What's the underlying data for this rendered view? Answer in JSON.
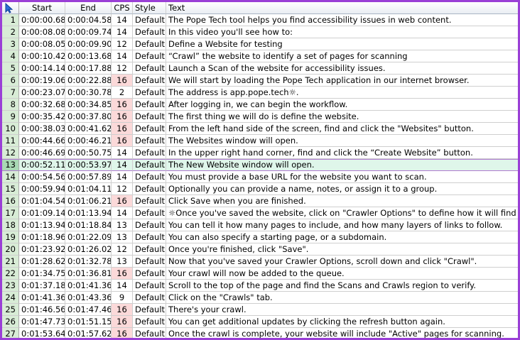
{
  "columns": {
    "num": "",
    "start": "Start",
    "end": "End",
    "cps": "CPS",
    "style": "Default_header_placeholder",
    "text": "Text"
  },
  "header_style_label": "Style",
  "selected_row": 13,
  "rows": [
    {
      "num": "1",
      "start": "0:00:00.68",
      "end": "0:00:04.58",
      "cps": "14",
      "style": "Default",
      "text": "The Pope Tech tool helps you find accessibility issues in web content."
    },
    {
      "num": "2",
      "start": "0:00:08.08",
      "end": "0:00:09.74",
      "cps": "14",
      "style": "Default",
      "text": "In this video you'll see how to:"
    },
    {
      "num": "3",
      "start": "0:00:08.05",
      "end": "0:00:09.90",
      "cps": "12",
      "style": "Default",
      "text": "Define a Website for testing"
    },
    {
      "num": "4",
      "start": "0:00:10.42",
      "end": "0:00:13.68",
      "cps": "14",
      "style": "Default",
      "text": "“Crawl” the website to identify a set of pages for scanning"
    },
    {
      "num": "5",
      "start": "0:00:14.14",
      "end": "0:00:17.88",
      "cps": "12",
      "style": "Default",
      "text": "Launch a Scan of the website for accessibility issues."
    },
    {
      "num": "6",
      "start": "0:00:19.06",
      "end": "0:00:22.88",
      "cps": "16",
      "style": "Default",
      "text": "We will start by loading the Pope Tech application in our internet browser."
    },
    {
      "num": "7",
      "start": "0:00:23.07",
      "end": "0:00:30.78",
      "cps": "2",
      "style": "Default",
      "text": "The address is app.pope.tech☼."
    },
    {
      "num": "8",
      "start": "0:00:32.68",
      "end": "0:00:34.85",
      "cps": "16",
      "style": "Default",
      "text": "After logging in, we can begin the workflow."
    },
    {
      "num": "9",
      "start": "0:00:35.42",
      "end": "0:00:37.80",
      "cps": "16",
      "style": "Default",
      "text": "The first thing we will do is define the website."
    },
    {
      "num": "10",
      "start": "0:00:38.03",
      "end": "0:00:41.62",
      "cps": "16",
      "style": "Default",
      "text": "From the left hand side of the screen, find and click the \"Websites\" button."
    },
    {
      "num": "11",
      "start": "0:00:44.66",
      "end": "0:00:46.21",
      "cps": "16",
      "style": "Default",
      "text": "The Websites window will open."
    },
    {
      "num": "12",
      "start": "0:00:46.69",
      "end": "0:00:50.75",
      "cps": "14",
      "style": "Default",
      "text": "In the upper right hand corner, find and click the “Create Website” button."
    },
    {
      "num": "13",
      "start": "0:00:52.11",
      "end": "0:00:53.97",
      "cps": "14",
      "style": "Default",
      "text": "The New Website window will open."
    },
    {
      "num": "14",
      "start": "0:00:54.56",
      "end": "0:00:57.89",
      "cps": "14",
      "style": "Default",
      "text": "You must provide a base URL for the website you want to scan."
    },
    {
      "num": "15",
      "start": "0:00:59.94",
      "end": "0:01:04.11",
      "cps": "12",
      "style": "Default",
      "text": "Optionally you can provide a name, notes, or assign it to a group."
    },
    {
      "num": "16",
      "start": "0:01:04.54",
      "end": "0:01:06.21",
      "cps": "16",
      "style": "Default",
      "text": "Click Save when you are finished."
    },
    {
      "num": "17",
      "start": "0:01:09.14",
      "end": "0:01:13.94",
      "cps": "14",
      "style": "Default",
      "text": "☼Once you've saved the website, click on \"Crawler Options\" to define how it will find pages."
    },
    {
      "num": "18",
      "start": "0:01:13.94",
      "end": "0:01:18.84",
      "cps": "13",
      "style": "Default",
      "text": "You can tell it how many pages to include, and how many layers of links to follow."
    },
    {
      "num": "19",
      "start": "0:01:18.96",
      "end": "0:01:22.09",
      "cps": "13",
      "style": "Default",
      "text": "You can also specify a starting page, or a subdomain."
    },
    {
      "num": "20",
      "start": "0:01:23.92",
      "end": "0:01:26.02",
      "cps": "12",
      "style": "Default",
      "text": "Once you're finished, click \"Save\"."
    },
    {
      "num": "21",
      "start": "0:01:28.62",
      "end": "0:01:32.78",
      "cps": "13",
      "style": "Default",
      "text": "Now that you've saved your Crawler Options, scroll down and click \"Crawl\"."
    },
    {
      "num": "22",
      "start": "0:01:34.75",
      "end": "0:01:36.81",
      "cps": "16",
      "style": "Default",
      "text": "Your crawl will now be added to the queue."
    },
    {
      "num": "23",
      "start": "0:01:37.18",
      "end": "0:01:41.36",
      "cps": "14",
      "style": "Default",
      "text": "Scroll to the top of the page and find the Scans and Crawls region to verify."
    },
    {
      "num": "24",
      "start": "0:01:41.36",
      "end": "0:01:43.36",
      "cps": "9",
      "style": "Default",
      "text": "Click on the \"Crawls\" tab."
    },
    {
      "num": "25",
      "start": "0:01:46.56",
      "end": "0:01:47.46",
      "cps": "16",
      "style": "Default",
      "text": "There's your crawl."
    },
    {
      "num": "26",
      "start": "0:01:47.73",
      "end": "0:01:51.15",
      "cps": "16",
      "style": "Default",
      "text": "You can get additional updates by clicking the refresh button again."
    },
    {
      "num": "27",
      "start": "0:01:53.64",
      "end": "0:01:57.62",
      "cps": "16",
      "style": "Default",
      "text": "Once the crawl is complete, your website will include \"Active\" pages for scanning."
    }
  ],
  "colors": {
    "frame": "#9a3fd6",
    "highlight_cps": "#fbd9d9",
    "selected_row": "#dff6ea",
    "row_number_bg": "#d8ecd6"
  },
  "icons": {
    "corner": "cursor-arrow-icon"
  }
}
